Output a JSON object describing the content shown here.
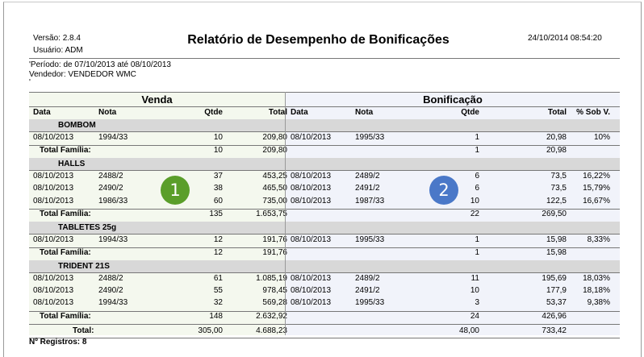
{
  "header": {
    "version": "Versão: 2.8.4",
    "user": "Usuário: ADM",
    "title": "Relatório de Desempenho de Bonificações",
    "datetime": "24/10/2014 08:54:20",
    "period": "'Período: de 07/10/2013 até 08/10/2013",
    "seller": "Vendedor: VENDEDOR WMC",
    "apostrophe": "'"
  },
  "groups": {
    "venda": "Venda",
    "bonificacao": "Bonificação"
  },
  "columns": {
    "data": "Data",
    "nota": "Nota",
    "qtde": "Qtde",
    "total": "Total",
    "pct": "% Sob V."
  },
  "sections": [
    {
      "name": "BOMBOM",
      "rows": [
        {
          "vdata": "08/10/2013",
          "vnota": "1994/33",
          "vqtde": "10",
          "vtotal": "209,80",
          "bdata": "08/10/2013",
          "bnota": "1995/33",
          "bqtde": "1",
          "btotal": "20,98",
          "pct": "10%"
        }
      ],
      "total": {
        "label": "Total Família:",
        "vqtde": "10",
        "vtotal": "209,80",
        "bqtde": "1",
        "btotal": "20,98"
      }
    },
    {
      "name": "HALLS",
      "rows": [
        {
          "vdata": "08/10/2013",
          "vnota": "2488/2",
          "vqtde": "37",
          "vtotal": "453,25",
          "bdata": "08/10/2013",
          "bnota": "2489/2",
          "bqtde": "6",
          "btotal": "73,5",
          "pct": "16,22%"
        },
        {
          "vdata": "08/10/2013",
          "vnota": "2490/2",
          "vqtde": "38",
          "vtotal": "465,50",
          "bdata": "08/10/2013",
          "bnota": "2491/2",
          "bqtde": "6",
          "btotal": "73,5",
          "pct": "15,79%"
        },
        {
          "vdata": "08/10/2013",
          "vnota": "1986/33",
          "vqtde": "60",
          "vtotal": "735,00",
          "bdata": "08/10/2013",
          "bnota": "1987/33",
          "bqtde": "10",
          "btotal": "122,5",
          "pct": "16,67%"
        }
      ],
      "total": {
        "label": "Total Família:",
        "vqtde": "135",
        "vtotal": "1.653,75",
        "bqtde": "22",
        "btotal": "269,50"
      }
    },
    {
      "name": "TABLETES 25g",
      "rows": [
        {
          "vdata": "08/10/2013",
          "vnota": "1994/33",
          "vqtde": "12",
          "vtotal": "191,76",
          "bdata": "08/10/2013",
          "bnota": "1995/33",
          "bqtde": "1",
          "btotal": "15,98",
          "pct": "8,33%"
        }
      ],
      "total": {
        "label": "Total Família:",
        "vqtde": "12",
        "vtotal": "191,76",
        "bqtde": "1",
        "btotal": "15,98"
      }
    },
    {
      "name": "TRIDENT 21S",
      "rows": [
        {
          "vdata": "08/10/2013",
          "vnota": "2488/2",
          "vqtde": "61",
          "vtotal": "1.085,19",
          "bdata": "08/10/2013",
          "bnota": "2489/2",
          "bqtde": "11",
          "btotal": "195,69",
          "pct": "18,03%"
        },
        {
          "vdata": "08/10/2013",
          "vnota": "2490/2",
          "vqtde": "55",
          "vtotal": "978,45",
          "bdata": "08/10/2013",
          "bnota": "2491/2",
          "bqtde": "10",
          "btotal": "177,9",
          "pct": "18,18%"
        },
        {
          "vdata": "08/10/2013",
          "vnota": "1994/33",
          "vqtde": "32",
          "vtotal": "569,28",
          "bdata": "08/10/2013",
          "bnota": "1995/33",
          "bqtde": "3",
          "btotal": "53,37",
          "pct": "9,38%"
        }
      ],
      "total": {
        "label": "Total Família:",
        "vqtde": "148",
        "vtotal": "2.632,92",
        "bqtde": "24",
        "btotal": "426,96"
      }
    }
  ],
  "grand_total": {
    "label": "Total:",
    "vqtde": "305,00",
    "vtotal": "4.688,23",
    "bqtde": "48,00",
    "btotal": "733,42"
  },
  "footer": {
    "records": "Nº Registros: 8"
  },
  "badges": [
    {
      "label": "1",
      "color": "#5a9e2a"
    },
    {
      "label": "2",
      "color": "#4a78c8"
    }
  ]
}
